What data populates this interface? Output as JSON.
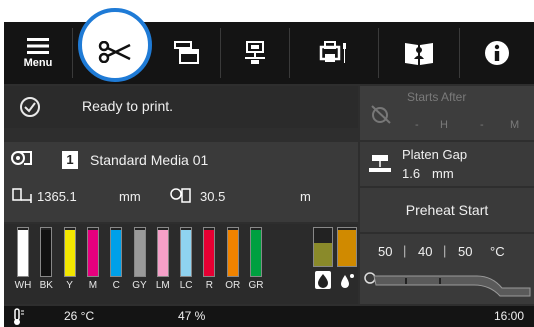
{
  "toolbar": {
    "menu_label": "Menu"
  },
  "status": {
    "message": "Ready to print."
  },
  "starts_after": {
    "label": "Starts After",
    "hours": "-",
    "h_unit": "H",
    "minutes": "-",
    "m_unit": "M"
  },
  "media": {
    "number": "1",
    "name": "Standard Media 01",
    "remaining_length": "1365.1",
    "remaining_length_unit": "mm",
    "roll_length": "30.5",
    "roll_length_unit": "m"
  },
  "platen": {
    "label": "Platen Gap",
    "value": "1.6",
    "unit": "mm"
  },
  "preheat": {
    "button_label": "Preheat Start"
  },
  "temperatures": {
    "t1": "50",
    "t2": "40",
    "t3": "50",
    "unit": "°C"
  },
  "inks": [
    {
      "label": "WH",
      "color": "#ffffff",
      "level": 0.95
    },
    {
      "label": "BK",
      "color": "#111111",
      "level": 0.95
    },
    {
      "label": "Y",
      "color": "#f2e600",
      "level": 0.95
    },
    {
      "label": "M",
      "color": "#e6007e",
      "level": 0.95
    },
    {
      "label": "C",
      "color": "#00a0e9",
      "level": 0.95
    },
    {
      "label": "GY",
      "color": "#9a9a9a",
      "level": 0.95
    },
    {
      "label": "LM",
      "color": "#f5a0c8",
      "level": 0.95
    },
    {
      "label": "LC",
      "color": "#8fd3f0",
      "level": 0.95
    },
    {
      "label": "R",
      "color": "#e60033",
      "level": 0.95
    },
    {
      "label": "OR",
      "color": "#f08300",
      "level": 0.95
    },
    {
      "label": "GR",
      "color": "#00a040",
      "level": 0.95
    }
  ],
  "maintenance": [
    {
      "name": "waste-ink",
      "color": "#8a8a2a",
      "level": 0.6
    },
    {
      "name": "cleaning-liquid",
      "color": "#d08a00",
      "level": 0.95
    }
  ],
  "status_bar": {
    "temperature": "26 °C",
    "humidity": "47 %",
    "clock": "16:00"
  },
  "colors": {
    "callout": "#1f7bd6",
    "toolbar_bg": "#141414",
    "panel_bg": "#3a3a3a"
  }
}
